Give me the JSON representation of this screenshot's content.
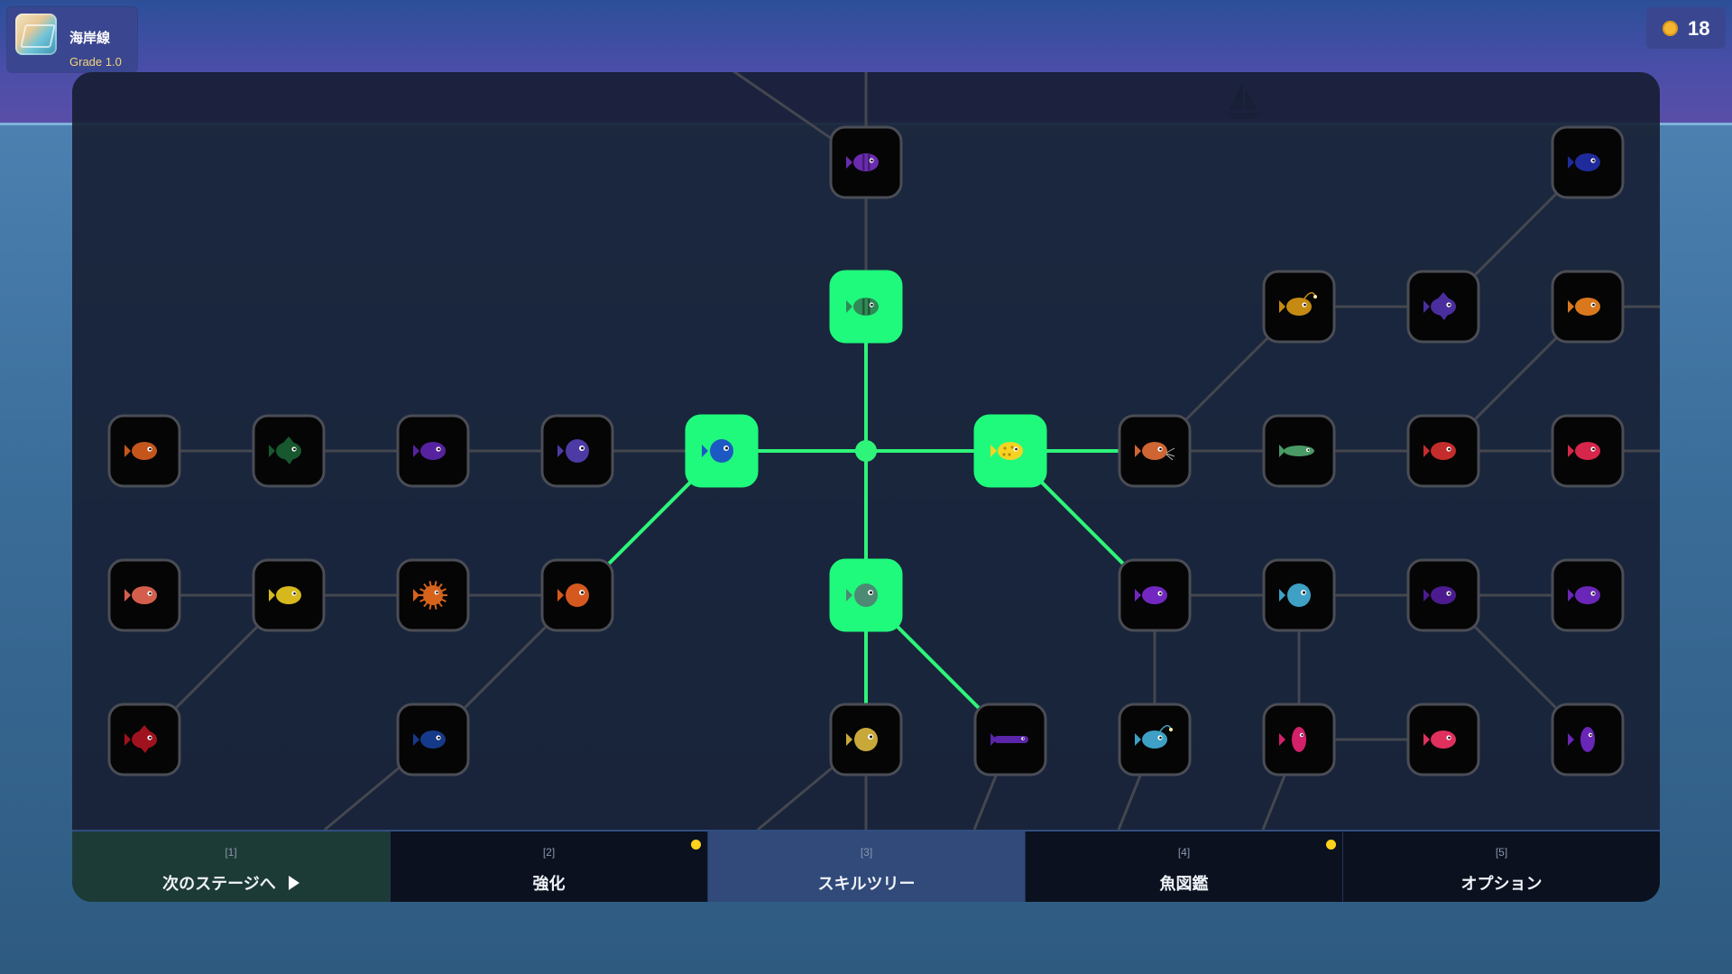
{
  "stage": {
    "name": "海岸線",
    "grade": "Grade 1.0"
  },
  "currency": {
    "icon": "gold-coin-icon",
    "amount": "18"
  },
  "colors": {
    "unlocked_fill": "#1ffa7c",
    "unlocked_line": "#2ef57a",
    "locked_fill": "#050505",
    "locked_border": "#4a4d55",
    "locked_line": "#44474f",
    "notification": "#ffd21c"
  },
  "skill_tree": {
    "center": "root",
    "nodes": [
      {
        "id": "root",
        "kind": "root",
        "state": "unlocked"
      },
      {
        "id": "n-top1",
        "color": "#6b2bb0",
        "shape": "barred",
        "state": "locked"
      },
      {
        "id": "n-top2",
        "color": "#2f8a56",
        "shape": "barred",
        "state": "unlocked"
      },
      {
        "id": "n-left",
        "color": "#1c59c2",
        "shape": "round",
        "state": "unlocked"
      },
      {
        "id": "n-right",
        "color": "#f6d323",
        "shape": "spotted",
        "state": "unlocked"
      },
      {
        "id": "n-down",
        "color": "#4c8a74",
        "shape": "round",
        "state": "unlocked"
      },
      {
        "id": "n-tr1",
        "color": "#1f2b9b",
        "shape": "oval",
        "state": "locked"
      },
      {
        "id": "n-tr2",
        "color": "#c48a12",
        "shape": "angler",
        "state": "locked"
      },
      {
        "id": "n-tr3",
        "color": "#4a2e9d",
        "shape": "spiky",
        "state": "locked"
      },
      {
        "id": "n-tr4",
        "color": "#d9781c",
        "shape": "oval",
        "state": "locked"
      },
      {
        "id": "n-l4",
        "color": "#c4561c",
        "shape": "oval",
        "state": "locked"
      },
      {
        "id": "n-l3",
        "color": "#18582e",
        "shape": "spiky",
        "state": "locked"
      },
      {
        "id": "n-l2",
        "color": "#5722a0",
        "shape": "oval",
        "state": "locked"
      },
      {
        "id": "n-l1",
        "color": "#4d3aa5",
        "shape": "round",
        "state": "locked"
      },
      {
        "id": "n-r1",
        "color": "#d06534",
        "shape": "whisker",
        "state": "locked"
      },
      {
        "id": "n-r2",
        "color": "#4a9a66",
        "shape": "long",
        "state": "locked"
      },
      {
        "id": "n-r3",
        "color": "#c42d2b",
        "shape": "oval",
        "state": "locked"
      },
      {
        "id": "n-r4",
        "color": "#d7264b",
        "shape": "oval",
        "state": "locked"
      },
      {
        "id": "n-ml4",
        "color": "#d45e4c",
        "shape": "oval",
        "state": "locked"
      },
      {
        "id": "n-ml3",
        "color": "#d6b81d",
        "shape": "oval",
        "state": "locked"
      },
      {
        "id": "n-ml2",
        "color": "#d5631c",
        "shape": "puffer",
        "state": "locked"
      },
      {
        "id": "n-ml1",
        "color": "#d5591f",
        "shape": "round",
        "state": "locked"
      },
      {
        "id": "n-mr1",
        "color": "#7227c0",
        "shape": "oval",
        "state": "locked"
      },
      {
        "id": "n-mr2",
        "color": "#3ea0c5",
        "shape": "round",
        "state": "locked"
      },
      {
        "id": "n-mr3",
        "color": "#4b1b8f",
        "shape": "oval",
        "state": "locked"
      },
      {
        "id": "n-mr4",
        "color": "#6a26b6",
        "shape": "oval",
        "state": "locked"
      },
      {
        "id": "n-bl4",
        "color": "#a0121e",
        "shape": "spiky",
        "state": "locked"
      },
      {
        "id": "n-bl2",
        "color": "#163a8a",
        "shape": "oval",
        "state": "locked"
      },
      {
        "id": "n-bc",
        "color": "#c9a83a",
        "shape": "round",
        "state": "locked"
      },
      {
        "id": "n-bd",
        "color": "#5a25a8",
        "shape": "eel",
        "state": "locked"
      },
      {
        "id": "n-br1",
        "color": "#3ea0c5",
        "shape": "angler",
        "state": "locked"
      },
      {
        "id": "n-br2",
        "color": "#d3206a",
        "shape": "tall",
        "state": "locked"
      },
      {
        "id": "n-br3",
        "color": "#e0305e",
        "shape": "oval",
        "state": "locked"
      },
      {
        "id": "n-br4",
        "color": "#6a26b6",
        "shape": "tall",
        "state": "locked"
      }
    ],
    "edges": [
      [
        "root",
        "n-top2"
      ],
      [
        "n-top2",
        "n-top1"
      ],
      [
        "root",
        "n-left"
      ],
      [
        "root",
        "n-right"
      ],
      [
        "root",
        "n-down"
      ],
      [
        "n-left",
        "n-l1"
      ],
      [
        "n-l1",
        "n-l2"
      ],
      [
        "n-l2",
        "n-l3"
      ],
      [
        "n-l3",
        "n-l4"
      ],
      [
        "n-left",
        "n-ml1"
      ],
      [
        "n-ml1",
        "n-ml2"
      ],
      [
        "n-ml2",
        "n-ml3"
      ],
      [
        "n-ml3",
        "n-ml4"
      ],
      [
        "n-ml3",
        "n-bl4"
      ],
      [
        "n-ml1",
        "n-bl2"
      ],
      [
        "n-right",
        "n-r1"
      ],
      [
        "n-r1",
        "n-r2"
      ],
      [
        "n-r2",
        "n-r3"
      ],
      [
        "n-r3",
        "n-r4"
      ],
      [
        "n-r1",
        "n-tr2"
      ],
      [
        "n-tr2",
        "n-tr3"
      ],
      [
        "n-tr3",
        "n-tr1"
      ],
      [
        "n-r3",
        "n-tr4"
      ],
      [
        "n-right",
        "n-mr1"
      ],
      [
        "n-mr1",
        "n-mr2"
      ],
      [
        "n-mr2",
        "n-mr3"
      ],
      [
        "n-mr3",
        "n-mr4"
      ],
      [
        "n-mr1",
        "n-br1"
      ],
      [
        "n-mr2",
        "n-br2"
      ],
      [
        "n-br2",
        "n-br3"
      ],
      [
        "n-mr3",
        "n-br4"
      ],
      [
        "n-down",
        "n-bc"
      ],
      [
        "n-down",
        "n-bd"
      ]
    ]
  },
  "tabs": [
    {
      "key": "[1]",
      "label": "次のステージへ",
      "icon": "play-arrow-icon",
      "has_notification": false,
      "active": false
    },
    {
      "key": "[2]",
      "label": "強化",
      "has_notification": true,
      "active": false
    },
    {
      "key": "[3]",
      "label": "スキルツリー",
      "has_notification": false,
      "active": true
    },
    {
      "key": "[4]",
      "label": "魚図鑑",
      "has_notification": true,
      "active": false
    },
    {
      "key": "[5]",
      "label": "オプション",
      "has_notification": false,
      "active": false
    }
  ]
}
